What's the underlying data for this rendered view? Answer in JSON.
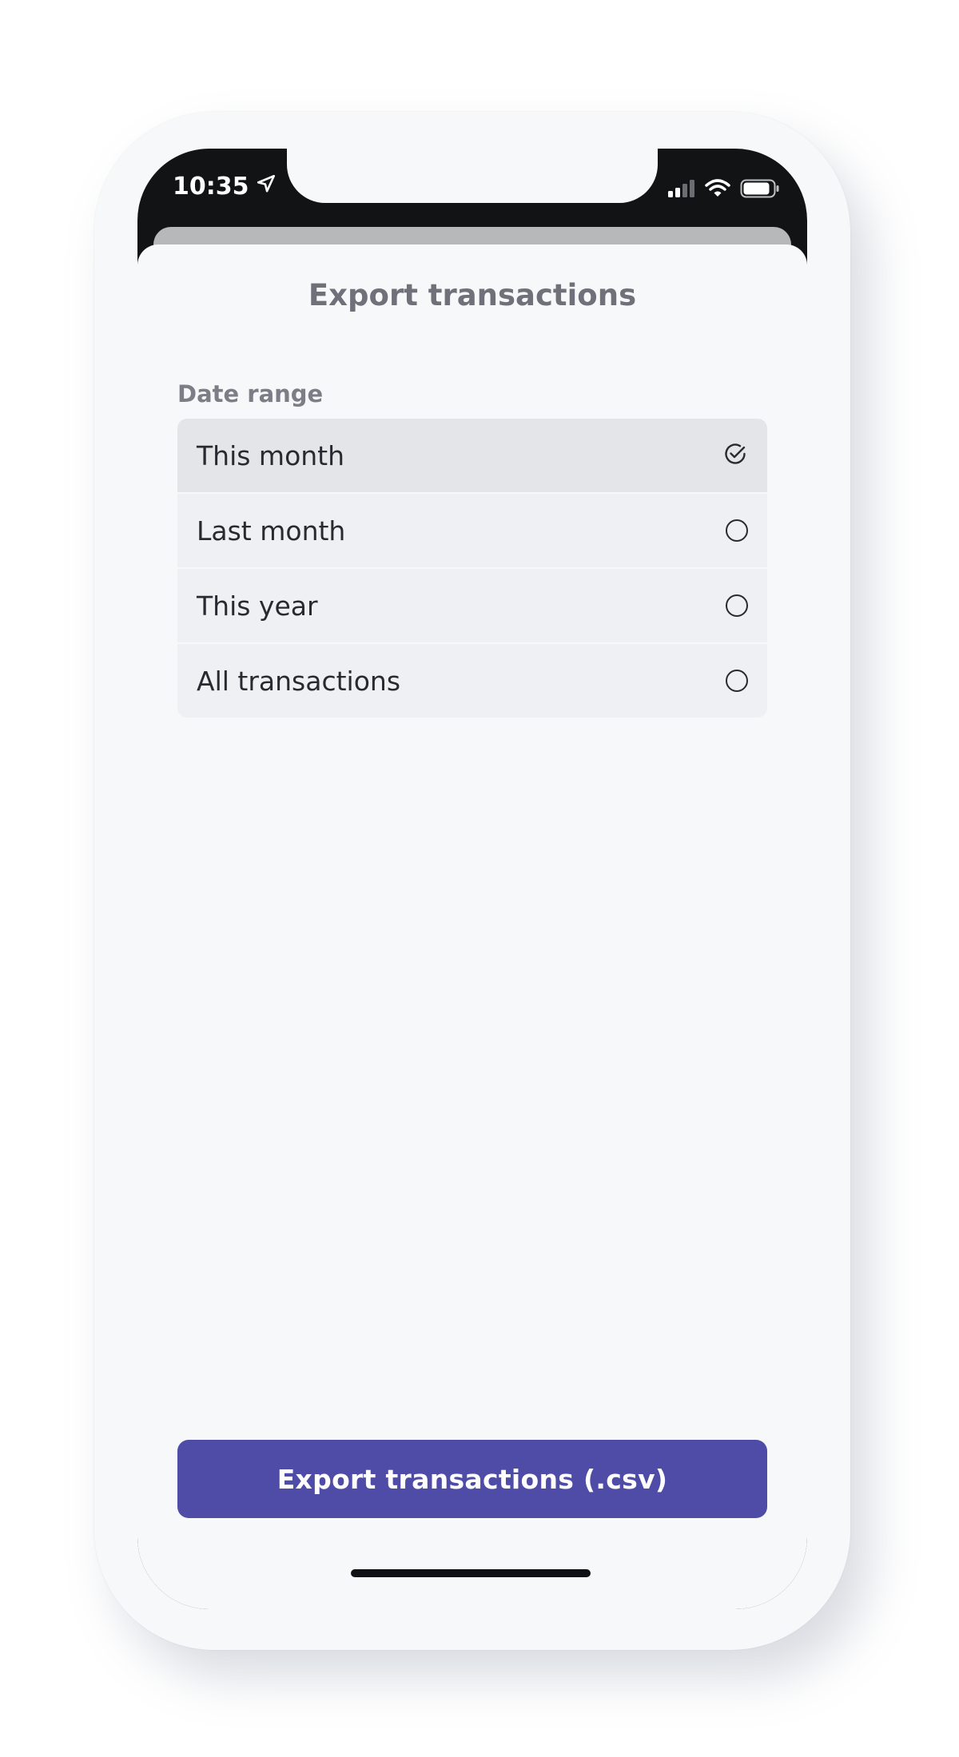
{
  "status_bar": {
    "time": "10:35"
  },
  "sheet": {
    "title": "Export transactions",
    "section_label": "Date range",
    "options": [
      {
        "label": "This month",
        "selected": true
      },
      {
        "label": "Last month",
        "selected": false
      },
      {
        "label": "This year",
        "selected": false
      },
      {
        "label": "All transactions",
        "selected": false
      }
    ],
    "export_button_label": "Export transactions (.csv)"
  },
  "colors": {
    "accent": "#4f4ca7",
    "background": "#f7f8f9",
    "option_bg": "#eff0f3",
    "option_selected_bg": "#e4e5e8",
    "text": "#272a30"
  },
  "icons": {
    "location": "location-arrow-icon",
    "signal": "cellular-signal-icon",
    "wifi": "wifi-icon",
    "battery": "battery-icon",
    "selected": "check-circle-icon",
    "unselected": "radio-circle-icon"
  }
}
